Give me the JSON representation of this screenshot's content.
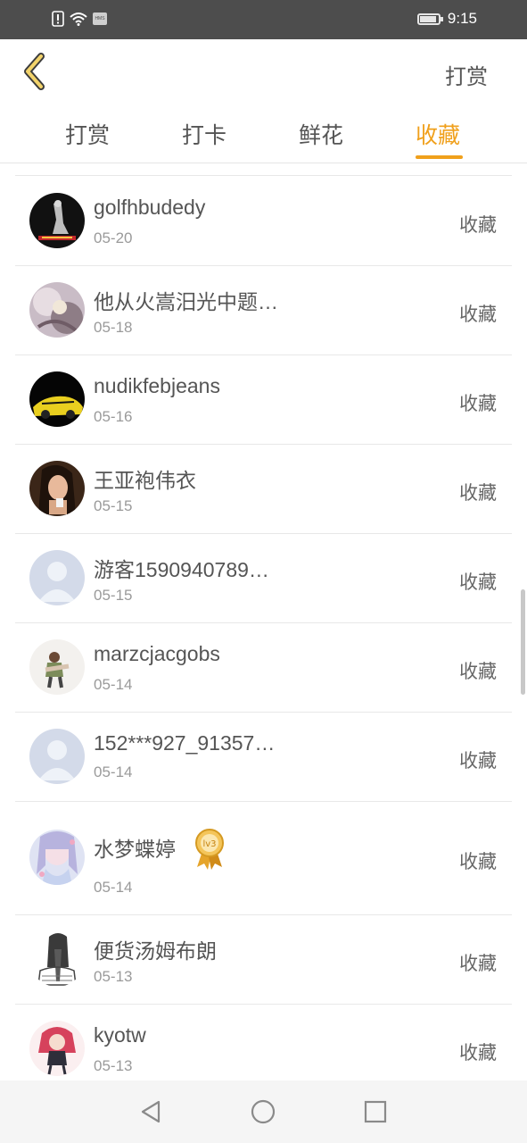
{
  "status_bar": {
    "time": "9:15",
    "icons": [
      "alert-icon",
      "wifi-icon",
      "hms-icon",
      "battery-icon"
    ],
    "hms_label": "HMS"
  },
  "header": {
    "back_icon": "chevron-left-icon",
    "title": "打赏"
  },
  "tabs": [
    {
      "label": "打赏",
      "active": false
    },
    {
      "label": "打卡",
      "active": false
    },
    {
      "label": "鲜花",
      "active": false
    },
    {
      "label": "收藏",
      "active": true
    }
  ],
  "colors": {
    "accent": "#f0a01c",
    "status_bar_bg": "#4d4d4d",
    "text_primary": "#555555",
    "text_secondary": "#9a9a9a"
  },
  "list": [
    {
      "name": "golfhbudedy",
      "date": "05-20",
      "action": "收藏",
      "avatar": "photo-avatar-dark"
    },
    {
      "name": "他从火嵩汨光中题…",
      "date": "05-18",
      "action": "收藏",
      "avatar": "photo-avatar-pastel"
    },
    {
      "name": "nudikfebjeans",
      "date": "05-16",
      "action": "收藏",
      "avatar": "photo-avatar-car"
    },
    {
      "name": "王亚袍伟衣",
      "date": "05-15",
      "action": "收藏",
      "avatar": "photo-avatar-portrait"
    },
    {
      "name": "游客1590940789…",
      "date": "05-15",
      "action": "收藏",
      "avatar": "default-avatar"
    },
    {
      "name": "marzcjacgobs",
      "date": "05-14",
      "action": "收藏",
      "avatar": "photo-avatar-couple"
    },
    {
      "name": "152***927_91357…",
      "date": "05-14",
      "action": "收藏",
      "avatar": "default-avatar"
    },
    {
      "name": "水梦蝶婷",
      "date": "05-14",
      "action": "收藏",
      "avatar": "photo-avatar-anime",
      "badge": "lv3"
    },
    {
      "name": "便货汤姆布朗",
      "date": "05-13",
      "action": "收藏",
      "avatar": "sketch-avatar"
    },
    {
      "name": "kyotw",
      "date": "05-13",
      "action": "收藏",
      "avatar": "photo-avatar-anime-red"
    }
  ],
  "nav_bar": {
    "buttons": [
      "back-triangle-icon",
      "home-circle-icon",
      "recents-square-icon"
    ]
  }
}
